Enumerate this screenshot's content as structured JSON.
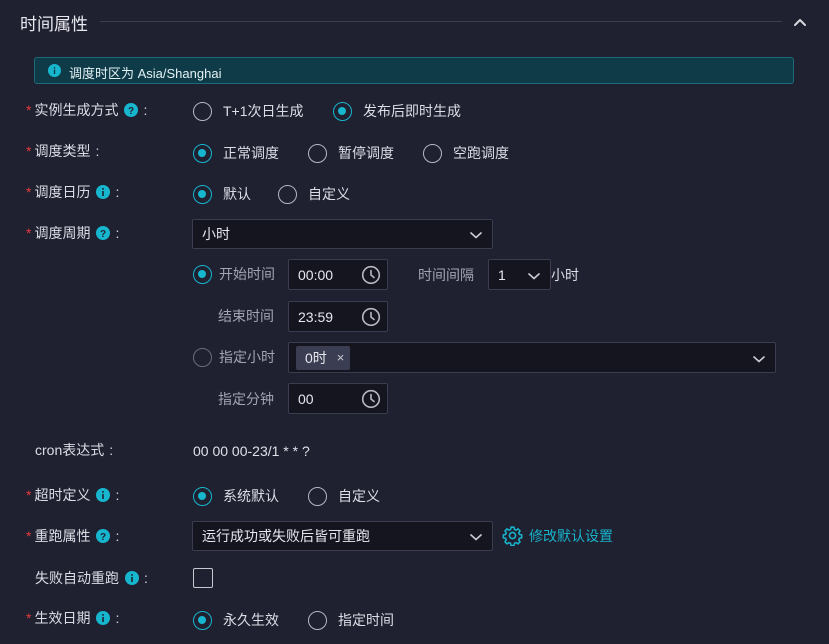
{
  "section": {
    "title": "时间属性"
  },
  "banner": {
    "text": "调度时区为 Asia/Shanghai"
  },
  "fields": {
    "instance_gen": {
      "label": "实例生成方式",
      "options": [
        "T+1次日生成",
        "发布后即时生成"
      ],
      "selected": 1
    },
    "schedule_type": {
      "label": "调度类型",
      "options": [
        "正常调度",
        "暂停调度",
        "空跑调度"
      ],
      "selected": 0
    },
    "calendar": {
      "label": "调度日历",
      "options": [
        "默认",
        "自定义"
      ],
      "selected": 0
    },
    "period": {
      "label": "调度周期",
      "value": "小时",
      "start_time": {
        "label": "开始时间",
        "value": "00:00",
        "selected": true
      },
      "interval": {
        "label": "时间间隔",
        "value": "1",
        "unit": "小时"
      },
      "end_time": {
        "label": "结束时间",
        "value": "23:59"
      },
      "specify_hour": {
        "label": "指定小时",
        "tag": "0时",
        "tag_close": "×",
        "selected": false
      },
      "specify_minute": {
        "label": "指定分钟",
        "value": "00"
      }
    },
    "cron": {
      "label": "cron表达式",
      "value": "00 00 00-23/1 * * ?"
    },
    "timeout": {
      "label": "超时定义",
      "options": [
        "系统默认",
        "自定义"
      ],
      "selected": 0
    },
    "rerun": {
      "label": "重跑属性",
      "value": "运行成功或失败后皆可重跑",
      "link": "修改默认设置"
    },
    "auto_rerun": {
      "label": "失败自动重跑",
      "checked": false
    },
    "effective_date": {
      "label": "生效日期",
      "options": [
        "永久生效",
        "指定时间"
      ],
      "selected": 0
    }
  },
  "colon": ":",
  "required_mark": "*",
  "colors": {
    "accent": "#17b6cf",
    "required": "#e23b3b",
    "background": "#1f2030",
    "banner_bg": "#0f3a47"
  },
  "icons": {
    "collapse": "chevron-up-icon",
    "info": "info-icon",
    "help": "help-icon",
    "clock": "clock-icon",
    "dropdown": "chevron-down-icon",
    "settings": "gear-icon"
  }
}
